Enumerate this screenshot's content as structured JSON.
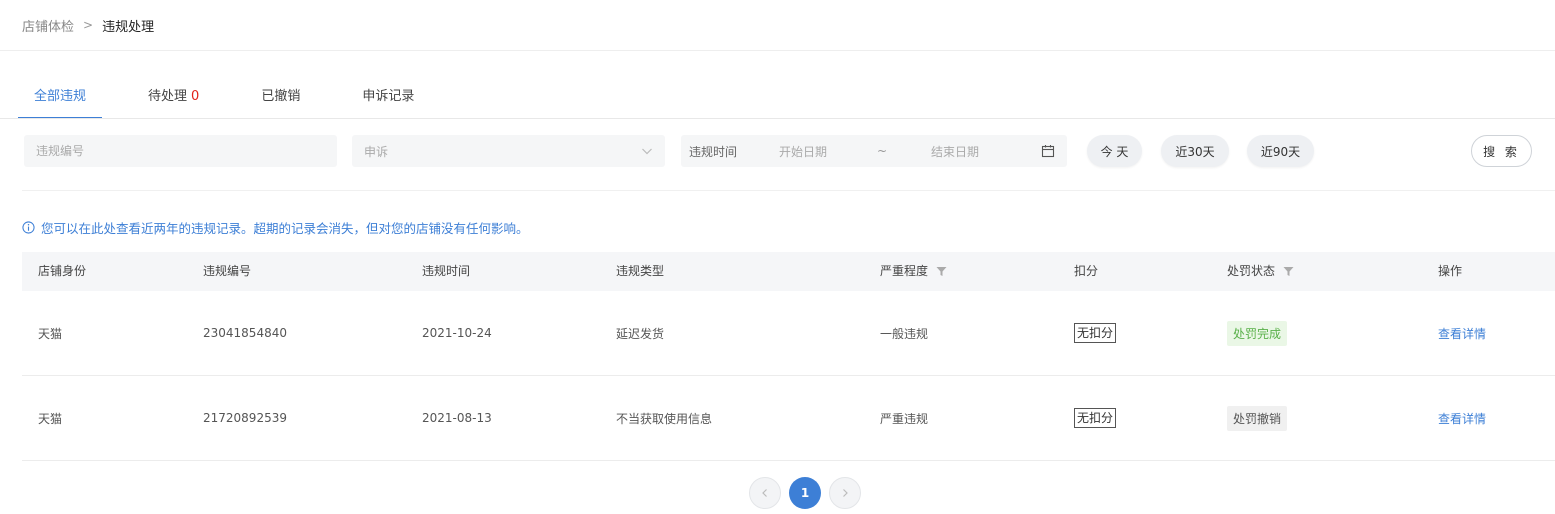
{
  "breadcrumb": {
    "parent": "店铺体检",
    "separator": ">",
    "current": "违规处理"
  },
  "tabs": [
    {
      "label": "全部违规",
      "count": ""
    },
    {
      "label": "待处理",
      "count": "0"
    },
    {
      "label": "已撤销",
      "count": ""
    },
    {
      "label": "申诉记录",
      "count": ""
    }
  ],
  "filters": {
    "violation_no_placeholder": "违规编号",
    "appeal_select_value": "申诉",
    "date_label": "违规时间",
    "start_date_placeholder": "开始日期",
    "range_sep": "~",
    "end_date_placeholder": "结束日期",
    "quick_today": "今 天",
    "quick_30": "近30天",
    "quick_90": "近90天",
    "search_label": "搜 索"
  },
  "notice": "您可以在此处查看近两年的违规记录。超期的记录会消失，但对您的店铺没有任何影响。",
  "table": {
    "headers": [
      "店铺身份",
      "违规编号",
      "违规时间",
      "违规类型",
      "严重程度",
      "扣分",
      "处罚状态",
      "操作"
    ],
    "rows": [
      {
        "shop": "天猫",
        "no": "23041854840",
        "date": "2021-10-24",
        "type": "延迟发货",
        "severity": "一般违规",
        "deduct": "无扣分",
        "status": "处罚完成",
        "action": "查看详情"
      },
      {
        "shop": "天猫",
        "no": "21720892539",
        "date": "2021-08-13",
        "type": "不当获取使用信息",
        "severity": "严重违规",
        "deduct": "无扣分",
        "status": "处罚撤销",
        "action": "查看详情"
      }
    ]
  },
  "pagination": {
    "current": "1"
  },
  "colors": {
    "accent": "#3d7fd6",
    "danger": "#e2231a",
    "success": "#5ab14a"
  }
}
